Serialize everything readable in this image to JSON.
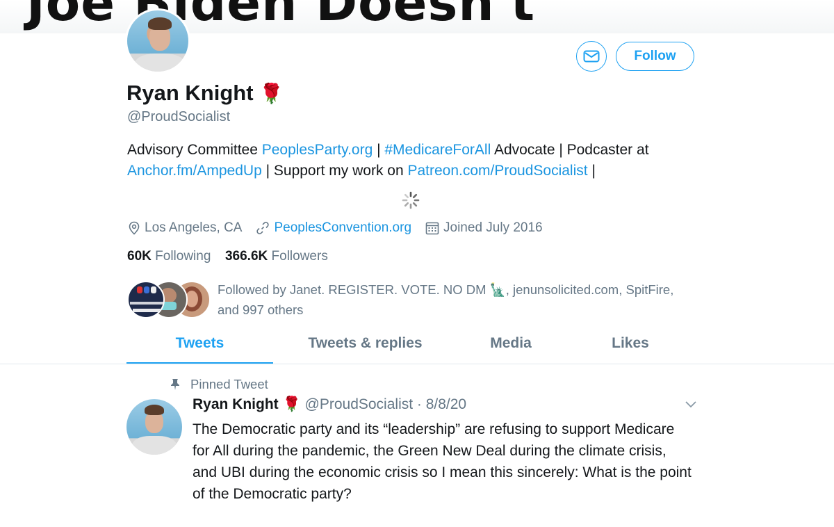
{
  "banner": {
    "text": "Joe Biden Doesn't"
  },
  "profile": {
    "name": "Ryan Knight",
    "name_emoji": "🌹",
    "handle": "@ProudSocialist",
    "follow_label": "Follow",
    "bio": {
      "t1": "Advisory Committee ",
      "l1": "PeoplesParty.org",
      "t2": " | ",
      "l2": "#MedicareForAll",
      "t3": " Advocate | Podcaster at ",
      "l3": "Anchor.fm/AmpedUp",
      "t4": " | Support my work on ",
      "l4": "Patreon.com/ProudSocialist",
      "t5": " |"
    },
    "location": "Los Angeles, CA",
    "website": "PeoplesConvention.org",
    "joined": "Joined July 2016",
    "following_count": "60K",
    "following_label": "Following",
    "followers_count": "366.6K",
    "followers_label": "Followers",
    "followed_by": "Followed by Janet. REGISTER. VOTE. NO DM 🗽, jenunsolicited.com, SpitFire, and 997 others"
  },
  "tabs": [
    {
      "label": "Tweets",
      "active": true
    },
    {
      "label": "Tweets & replies",
      "active": false
    },
    {
      "label": "Media",
      "active": false
    },
    {
      "label": "Likes",
      "active": false
    }
  ],
  "tweet": {
    "pinned_label": "Pinned Tweet",
    "name": "Ryan Knight",
    "name_emoji": "🌹",
    "handle_date": "@ProudSocialist · 8/8/20",
    "text": "The Democratic party and its “leadership” are refusing to support Medicare for All during the pandemic, the Green New Deal during the climate crisis, and UBI during the economic crisis so I mean this sincerely: What is the point of the Democratic party?"
  },
  "colors": {
    "accent": "#1da1f2",
    "link": "#1b95e0",
    "muted": "#657786",
    "text": "#14171a"
  }
}
